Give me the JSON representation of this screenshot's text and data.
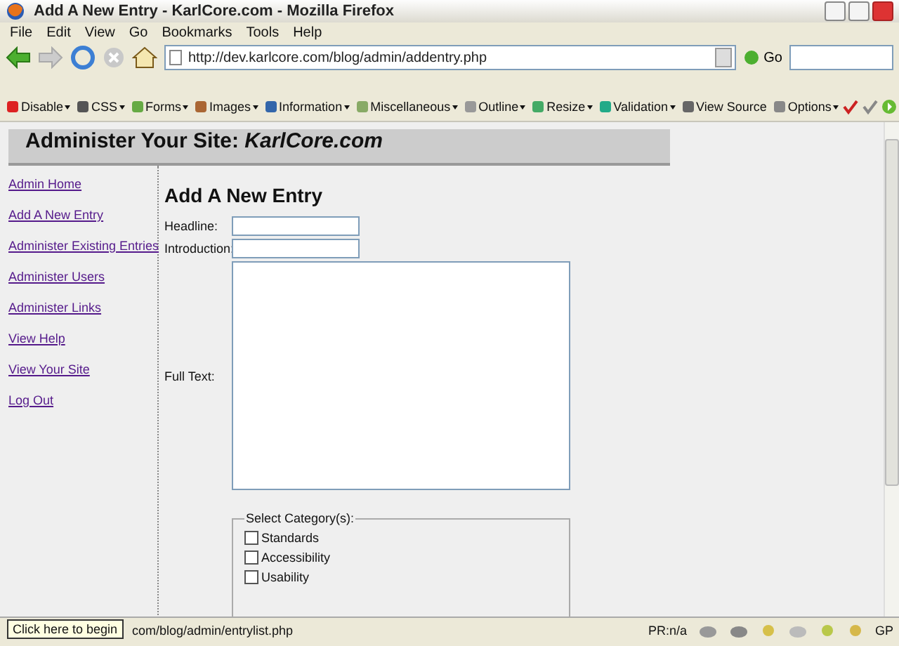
{
  "window": {
    "title": "Add A New Entry - KarlCore.com - Mozilla Firefox"
  },
  "menu": [
    "File",
    "Edit",
    "View",
    "Go",
    "Bookmarks",
    "Tools",
    "Help"
  ],
  "address_bar": {
    "url": "http://dev.karlcore.com/blog/admin/addentry.php",
    "go": "Go"
  },
  "dev_toolbar": [
    {
      "label": "Disable",
      "menu": true
    },
    {
      "label": "CSS",
      "menu": true
    },
    {
      "label": "Forms",
      "menu": true
    },
    {
      "label": "Images",
      "menu": true
    },
    {
      "label": "Information",
      "menu": true
    },
    {
      "label": "Miscellaneous",
      "menu": true
    },
    {
      "label": "Outline",
      "menu": true
    },
    {
      "label": "Resize",
      "menu": true
    },
    {
      "label": "Validation",
      "menu": true
    },
    {
      "label": "View Source",
      "menu": false
    },
    {
      "label": "Options",
      "menu": true
    }
  ],
  "page": {
    "header": "Administer Your Site: *KarlCore.com*",
    "sidebar": [
      "Admin Home",
      "Add A New Entry",
      "Administer Existing Entries",
      "Administer Users",
      "Administer Links",
      "View Help",
      "View Your Site",
      "Log Out"
    ],
    "heading": "Add A New Entry",
    "fields": [
      {
        "label": "Headline:",
        "kind": "input"
      },
      {
        "label": "Introduction:",
        "kind": "input"
      },
      {
        "label": "Full Text:",
        "kind": "textarea"
      }
    ],
    "category_group": {
      "legend": "Select Category(s):",
      "options": [
        {
          "label": "Standards",
          "checked": false
        },
        {
          "label": "Accessibility",
          "checked": false
        },
        {
          "label": "Usability",
          "checked": false
        }
      ]
    }
  },
  "status_bar": {
    "text": "com/blog/admin/entrylist.php",
    "tooltip": "Click here to begin",
    "pagerank": "PR:n/a",
    "gp": "GP"
  }
}
